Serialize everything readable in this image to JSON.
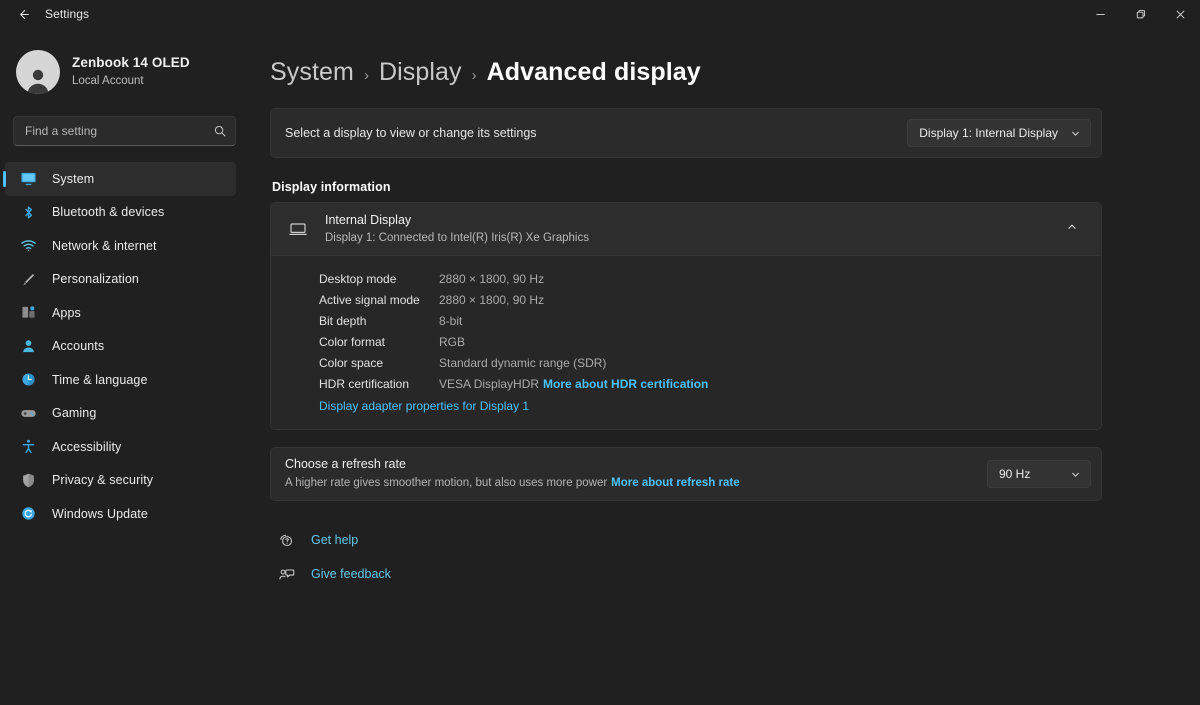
{
  "titlebar": {
    "back_icon": "back-arrow-icon",
    "app_title": "Settings",
    "minimize_label": "–",
    "restore_label": "❐",
    "close_label": "✕"
  },
  "sidebar": {
    "account": {
      "name": "Zenbook 14 OLED",
      "subtitle": "Local Account",
      "avatar_icon": "person-avatar-icon"
    },
    "search": {
      "placeholder": "Find a setting",
      "value": "",
      "icon": "search-icon"
    },
    "items": [
      {
        "label": "System",
        "icon": "system-icon",
        "selected": true
      },
      {
        "label": "Bluetooth & devices",
        "icon": "bluetooth-icon",
        "selected": false
      },
      {
        "label": "Network & internet",
        "icon": "network-wifi-icon",
        "selected": false
      },
      {
        "label": "Personalization",
        "icon": "personalization-brush-icon",
        "selected": false
      },
      {
        "label": "Apps",
        "icon": "apps-icon",
        "selected": false
      },
      {
        "label": "Accounts",
        "icon": "accounts-person-icon",
        "selected": false
      },
      {
        "label": "Time & language",
        "icon": "time-language-clock-icon",
        "selected": false
      },
      {
        "label": "Gaming",
        "icon": "gaming-controller-icon",
        "selected": false
      },
      {
        "label": "Accessibility",
        "icon": "accessibility-person-icon",
        "selected": false
      },
      {
        "label": "Privacy & security",
        "icon": "privacy-shield-icon",
        "selected": false
      },
      {
        "label": "Windows Update",
        "icon": "windows-update-refresh-icon",
        "selected": false
      }
    ]
  },
  "breadcrumb": {
    "segments": [
      "System",
      "Display",
      "Advanced display"
    ],
    "separator": "›"
  },
  "display_selector": {
    "label": "Select a display to view or change its settings",
    "selected": "Display 1: Internal Display",
    "chevron_icon": "chevron-down-icon"
  },
  "display_information": {
    "section_title": "Display information",
    "device_icon": "laptop-display-icon",
    "device_title": "Internal Display",
    "device_subtitle": "Display 1: Connected to Intel(R) Iris(R) Xe Graphics",
    "expander_icon": "chevron-up-icon",
    "rows": [
      {
        "key": "Desktop mode",
        "value": "2880 × 1800, 90 Hz",
        "link": ""
      },
      {
        "key": "Active signal mode",
        "value": "2880 × 1800, 90 Hz",
        "link": ""
      },
      {
        "key": "Bit depth",
        "value": "8-bit",
        "link": ""
      },
      {
        "key": "Color format",
        "value": "RGB",
        "link": ""
      },
      {
        "key": "Color space",
        "value": "Standard dynamic range (SDR)",
        "link": ""
      },
      {
        "key": "HDR certification",
        "value": "VESA DisplayHDR",
        "link": "More about HDR certification"
      }
    ],
    "adapter_link": "Display adapter properties for Display 1"
  },
  "refresh_rate": {
    "title": "Choose a refresh rate",
    "description": "A higher rate gives smoother motion, but also uses more power",
    "link": "More about refresh rate",
    "selected": "90 Hz",
    "chevron_icon": "chevron-down-icon"
  },
  "help_links": [
    {
      "label": "Get help",
      "icon": "get-help-icon"
    },
    {
      "label": "Give feedback",
      "icon": "give-feedback-icon"
    }
  ],
  "colors": {
    "accent": "#4cc2ff",
    "link": "#64c7e8",
    "window_bg": "#202020",
    "card_bg": "#2b2b2b",
    "card_body_bg": "#272727"
  }
}
